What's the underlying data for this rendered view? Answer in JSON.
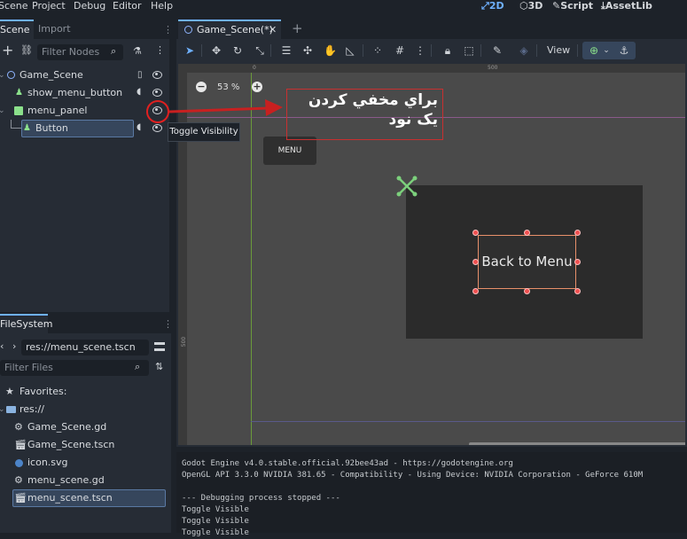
{
  "menubar": {
    "items": [
      "Scene",
      "Project",
      "Debug",
      "Editor",
      "Help"
    ],
    "modes": [
      "2D",
      "3D",
      "Script",
      "AssetLib"
    ]
  },
  "scene_dock": {
    "tabs": [
      "Scene",
      "Import"
    ],
    "filter_placeholder": "Filter Nodes",
    "nodes": [
      "Game_Scene",
      "show_menu_button",
      "menu_panel",
      "Button"
    ]
  },
  "filesystem": {
    "tab": "FileSystem",
    "path": "res://menu_scene.tscn",
    "filter_placeholder": "Filter Files",
    "favorites": "Favorites:",
    "root": "res://",
    "files": [
      "Game_Scene.gd",
      "Game_Scene.tscn",
      "icon.svg",
      "menu_scene.gd",
      "menu_scene.tscn"
    ]
  },
  "editor": {
    "tab_label": "Game_Scene(*)",
    "view_label": "View",
    "zoom": "53 %"
  },
  "viewport": {
    "menu_button": "MENU",
    "back_button": "Back to Menu",
    "annotation_line1": "براي مخفي كردن",
    "annotation_line2": "يک نود",
    "ruler_labels": [
      "0",
      "500",
      "500"
    ]
  },
  "tooltip": "Toggle Visibility",
  "output": {
    "lines": [
      "Godot Engine v4.0.stable.official.92bee43ad - https://godotengine.org",
      "OpenGL API 3.3.0 NVIDIA 381.65 - Compatibility - Using Device: NVIDIA Corporation - GeForce 610M",
      "",
      "--- Debugging process stopped ---",
      "Toggle Visible",
      "Toggle Visible",
      "Toggle Visible"
    ]
  },
  "colors": {
    "accent": "#6fb1ff",
    "annotation_red": "#e02020",
    "selection": "#36465c"
  }
}
